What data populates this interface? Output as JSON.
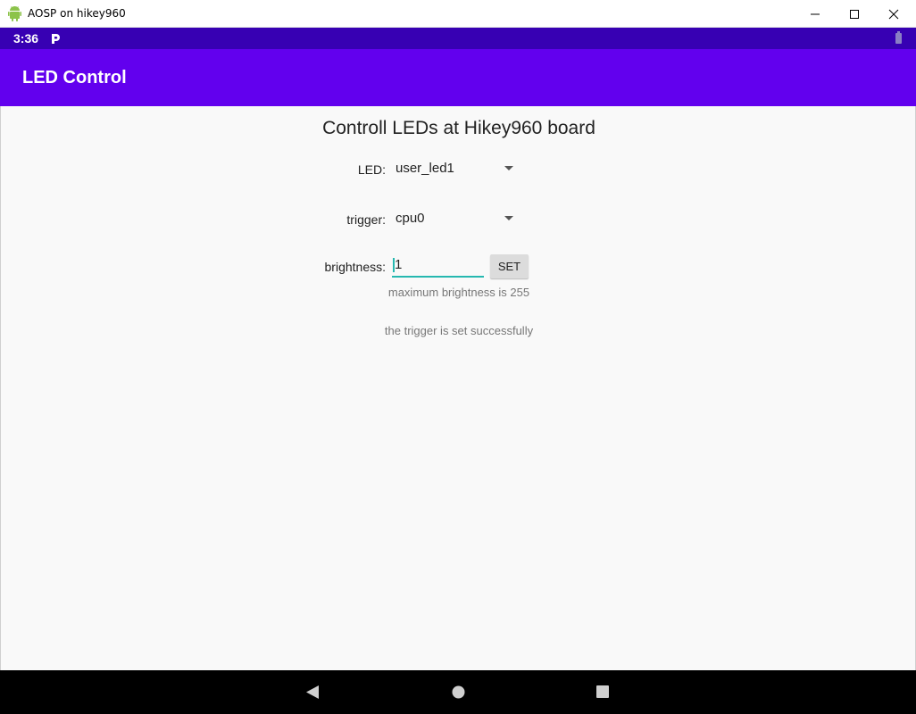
{
  "window": {
    "title": "AOSP on hikey960",
    "icons": [
      "android-icon",
      "minimize-icon",
      "maximize-icon",
      "close-icon"
    ]
  },
  "status_bar": {
    "time": "3:36",
    "icons": [
      "p-notification-icon",
      "battery-icon"
    ]
  },
  "app_bar": {
    "title": "LED Control"
  },
  "main": {
    "heading": "Controll LEDs at Hikey960 board",
    "led": {
      "label": "LED:",
      "selected": "user_led1"
    },
    "trigger": {
      "label": "trigger:",
      "selected": "cpu0"
    },
    "brightness": {
      "label": "brightness:",
      "value": "1",
      "set_label": "SET"
    },
    "max_hint": "maximum brightness is 255",
    "status_message": "the trigger is set successfully"
  },
  "nav_bar": {
    "icons": [
      "back-icon",
      "home-icon",
      "recents-icon"
    ]
  },
  "colors": {
    "status_bar": "#3700b3",
    "app_bar": "#6200ee",
    "accent": "#26b8b0",
    "background": "#f9f9f9"
  }
}
